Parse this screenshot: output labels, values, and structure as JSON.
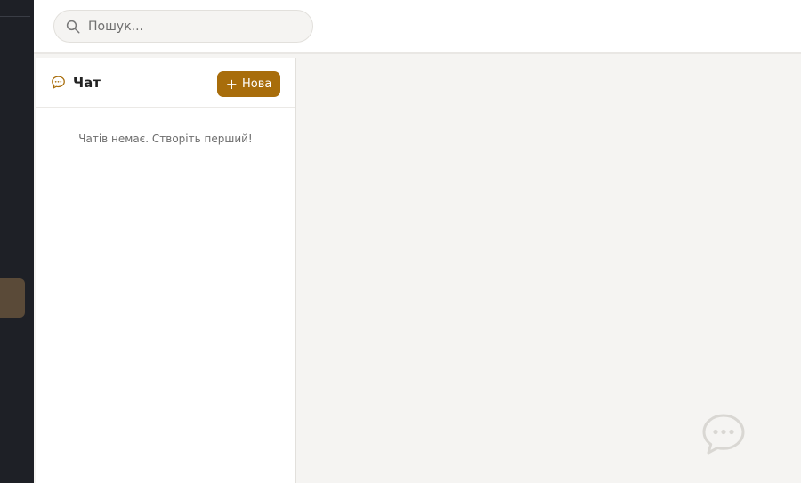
{
  "search": {
    "placeholder": "Пошук...",
    "icon": "search-icon"
  },
  "chat": {
    "title": "Чат",
    "icon": "speech-bubble-icon",
    "new_button_label": "Нова",
    "new_button_icon": "plus-icon",
    "empty_message": "Чатів немає. Створіть перший!"
  },
  "colors": {
    "accent": "#a86d0b",
    "rail_bg": "#1e2026",
    "panel_bg": "#ffffff",
    "page_bg": "#f5f4f2"
  },
  "floating": {
    "icon": "chat-bubble-icon"
  }
}
